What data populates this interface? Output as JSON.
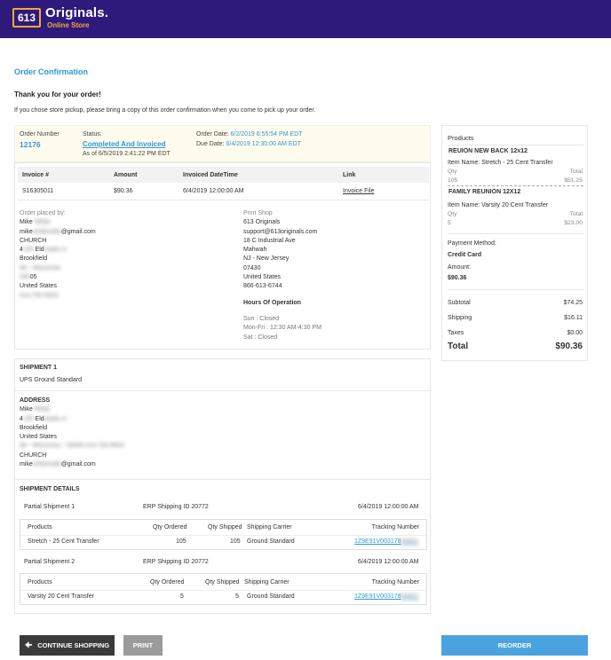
{
  "header": {
    "logo_mark": "613",
    "logo_name": "Originals.",
    "logo_sub": "Online Store",
    "bg_color": "#2e1a7a",
    "accent_color": "#f4a640"
  },
  "page": {
    "title": "Order Confirmation",
    "thanks": "Thank you for your order!",
    "intro": "If you chose store pickup, please bring a copy of this order confirmation when you come to pick up your order."
  },
  "order": {
    "number_label": "Order Number",
    "number": "12176",
    "status_label": "Status:",
    "status": "Completed And Invoiced",
    "status_asof": "As of 6/5/2019 2:41:22 PM EDT",
    "order_date_label": "Order Date:",
    "order_date": "6/2/2019 6:55:54 PM EDT",
    "due_date_label": "Due Date:",
    "due_date": "6/4/2019 12:30:00 AM EDT"
  },
  "invoice": {
    "headers": [
      "Invoice #",
      "Amount",
      "Invoiced DateTime",
      "Link"
    ],
    "row": {
      "number": "S16305011",
      "amount": "$90.36",
      "datetime": "6/4/2019 12:00:00 AM",
      "link": "Invoice File"
    }
  },
  "placed_by": {
    "label": "Order placed by:",
    "name": "Mike",
    "name_blur": "White",
    "email_a": "mike",
    "email_blur": "whitesville",
    "email_b": "@gmail.com",
    "company": "CHURCH",
    "addr1_a": "4",
    "addr1_blur1": "135",
    "addr1_b": " Eld",
    "addr1_blur2": "orado ct",
    "city": "Brookfield",
    "state_blur": "WI - Wisconsin",
    "zip_blur": "530",
    "zip_b": "05",
    "country": "United States",
    "phone_blur": "414-702-9924"
  },
  "print_shop": {
    "label": "Print Shop",
    "name": "613 Originals",
    "email": "support@613originals.com",
    "addr1": "18 C Industrial Ave",
    "city": "Mahwah",
    "state": "NJ - New Jersey",
    "zip": "07430",
    "country": "United States",
    "phone": "866-613-6744",
    "hours_title": "Hours Of Operation",
    "hours": [
      "Sun : Closed",
      "Mon-Fri : 12:30 AM-4:30 PM",
      "Sat : Closed"
    ]
  },
  "shipment": {
    "title": "SHIPMENT 1",
    "method": "UPS Ground Standard",
    "address_title": "ADDRESS",
    "name": "Mike",
    "name_blur": "White",
    "addr1_a": "4",
    "addr1_blur1": "135",
    "addr1_b": " Eld",
    "addr1_blur2": "orado ct",
    "city": "Brookfield",
    "country": "United States",
    "state_line_blur": "WI - Wisconsin - 53005 414-702-9924",
    "company": "CHURCH",
    "email_a": "mike",
    "email_blur": "whitesville",
    "email_b": "@gmail.com"
  },
  "shipment_details": {
    "title": "SHIPMENT DETAILS",
    "col_headers": [
      "Products",
      "Qty Ordered",
      "Qty Shipped",
      "Shipping Carrier",
      "Tracking Number"
    ],
    "partials": [
      {
        "name": "Partial Shipment 1",
        "erp": "ERP Shipping ID 20772",
        "date": "6/4/2019 12:00:00 AM",
        "product": "Stretch - 25 Cent Transfer",
        "qty_ordered": "105",
        "qty_shipped": "105",
        "carrier": "Ground Standard",
        "tracking": "1Z9E91V003178",
        "tracking_blur": "54321"
      },
      {
        "name": "Partial Shipment 2",
        "erp": "ERP Shipping ID 20772",
        "date": "6/4/2019 12:00:00 AM",
        "product": "Varsity 20 Cent Transfer",
        "qty_ordered": "5",
        "qty_shipped": "5",
        "carrier": "Ground Standard",
        "tracking": "1Z9E91V003178",
        "tracking_blur": "54321"
      }
    ]
  },
  "summary": {
    "products_title": "Products",
    "items": [
      {
        "title": "REUION NEW BACK 12x12",
        "item_name": "Item Name: Stretch - 25 Cent Transfer",
        "qty_label": "Qty",
        "total_label": "Total",
        "qty": "105",
        "total": "$51.25"
      },
      {
        "title": "FAMILY REUNION 12X12",
        "item_name": "Item Name: Varsity 20 Cent Transfer",
        "qty_label": "Qty",
        "total_label": "Total",
        "qty": "5",
        "total": "$23.00"
      }
    ],
    "payment_label": "Payment Method:",
    "payment_method": "Credit Card",
    "amount_label": "Amount:",
    "amount": "$90.36",
    "subtotal_label": "Subtotal",
    "subtotal": "$74.25",
    "shipping_label": "Shipping",
    "shipping": "$16.11",
    "taxes_label": "Taxes",
    "taxes": "$0.00",
    "total_label": "Total",
    "total": "$90.36"
  },
  "buttons": {
    "continue": "CONTINUE SHOPPING",
    "print": "PRINT",
    "reorder": "REORDER",
    "continue_color": "#3a3a3a",
    "print_color": "#9b9b9b",
    "reorder_color": "#4aa3df"
  }
}
